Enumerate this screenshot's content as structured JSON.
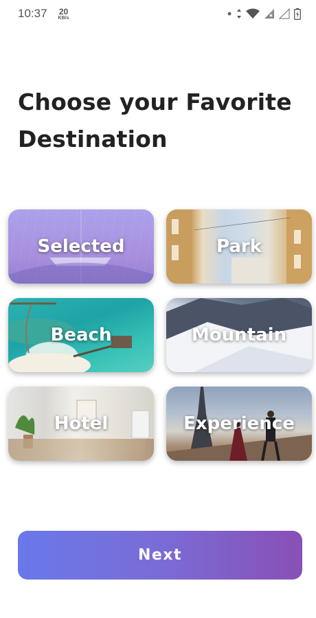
{
  "status_bar": {
    "time": "10:37",
    "net_speed_value": "20",
    "net_speed_unit": "KB/s"
  },
  "title": "Choose your Favorite Destination",
  "destinations": [
    {
      "label": "Selected",
      "image": "glass-hall"
    },
    {
      "label": "Park",
      "image": "city-street"
    },
    {
      "label": "Beach",
      "image": "tropical-island"
    },
    {
      "label": "Mountain",
      "image": "snowy-mountain"
    },
    {
      "label": "Hotel",
      "image": "hotel-room"
    },
    {
      "label": "Experience",
      "image": "eiffel-tower-couple"
    }
  ],
  "next_button": {
    "label": "Next"
  },
  "colors": {
    "button_gradient_start": "#6a78ea",
    "button_gradient_end": "#8850b6",
    "title": "#222222"
  }
}
